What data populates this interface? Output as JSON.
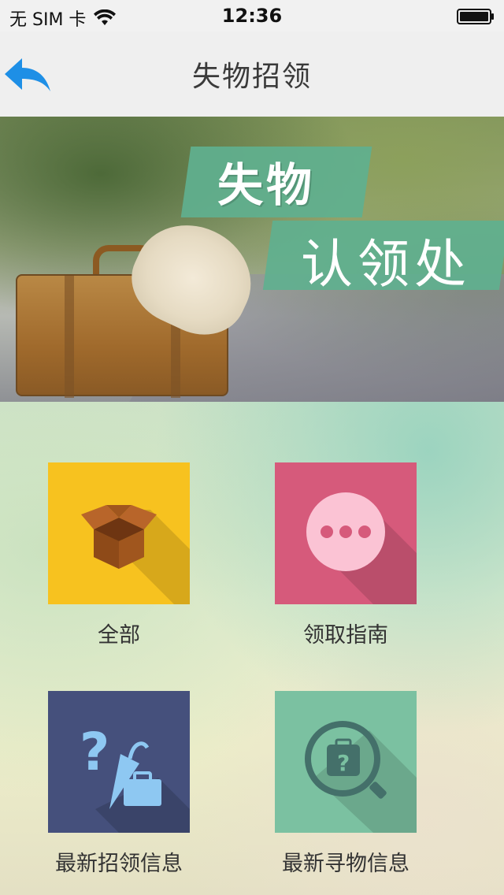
{
  "status_bar": {
    "carrier": "无 SIM 卡",
    "time": "12:36",
    "wifi_icon": "wifi-icon",
    "battery_icon": "battery-icon"
  },
  "nav": {
    "title": "失物招领",
    "back_icon": "back-arrow-icon"
  },
  "banner": {
    "line1": "失物",
    "line2": "认领处"
  },
  "menu": {
    "items": [
      {
        "label": "全部",
        "icon": "open-box-icon",
        "color": "#f7c21f"
      },
      {
        "label": "领取指南",
        "icon": "chat-dots-icon",
        "color": "#d65a7b"
      },
      {
        "label": "最新招领信息",
        "icon": "question-umbrella-bag-icon",
        "color": "#45507c"
      },
      {
        "label": "最新寻物信息",
        "icon": "search-luggage-icon",
        "color": "#7bc1a1"
      }
    ]
  },
  "colors": {
    "nav_bg": "#efefef",
    "banner_tag": "#5fb08f",
    "back_arrow": "#1e8fe6"
  }
}
